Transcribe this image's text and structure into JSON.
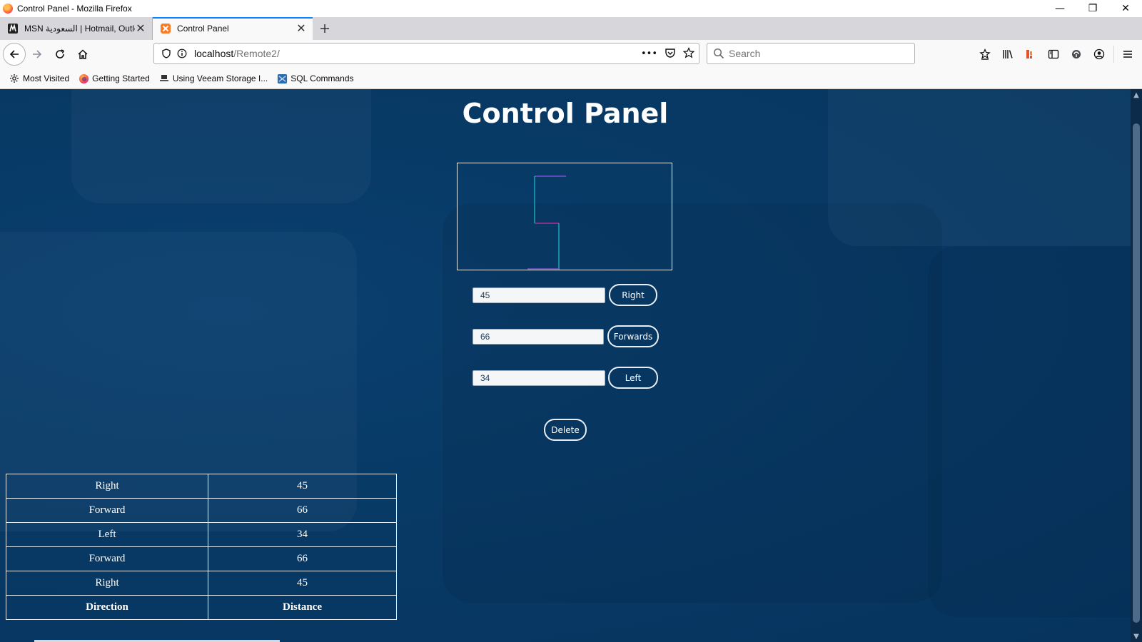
{
  "window": {
    "title": "Control Panel - Mozilla Firefox",
    "controls": {
      "minimize": "—",
      "restore": "❐",
      "close": "✕"
    }
  },
  "tabs": [
    {
      "label": "MSN السعودية | Hotmail, Outlo",
      "active": false,
      "icon": "msn-icon"
    },
    {
      "label": "Control Panel",
      "active": true,
      "icon": "xampp-icon"
    }
  ],
  "navbar": {
    "url_host": "localhost",
    "url_path": "/Remote2/",
    "overflow_label": "•••",
    "search_placeholder": "Search"
  },
  "bookmarks": [
    {
      "label": "Most Visited",
      "icon": "gear-icon"
    },
    {
      "label": "Getting Started",
      "icon": "firefox-icon"
    },
    {
      "label": "Using Veeam Storage I...",
      "icon": "veeam-icon"
    },
    {
      "label": "SQL Commands",
      "icon": "sql-icon"
    }
  ],
  "page": {
    "title": "Control Panel",
    "controls": [
      {
        "value": "45",
        "button": "Right"
      },
      {
        "value": "66",
        "button": "Forwards"
      },
      {
        "value": "34",
        "button": "Left"
      }
    ],
    "delete_label": "Delete",
    "log_table": {
      "rows": [
        {
          "direction": "Right",
          "distance": "45"
        },
        {
          "direction": "Forward",
          "distance": "66"
        },
        {
          "direction": "Left",
          "distance": "34"
        },
        {
          "direction": "Forward",
          "distance": "66"
        },
        {
          "direction": "Right",
          "distance": "45"
        }
      ],
      "header": {
        "direction": "Direction",
        "distance": "Distance"
      }
    }
  },
  "colors": {
    "page_background": "#073863",
    "active_tab_accent": "#0a84ff",
    "path_purple": "#7b4fd0",
    "path_teal": "#1aa7b8",
    "path_magenta": "#b0309a"
  }
}
